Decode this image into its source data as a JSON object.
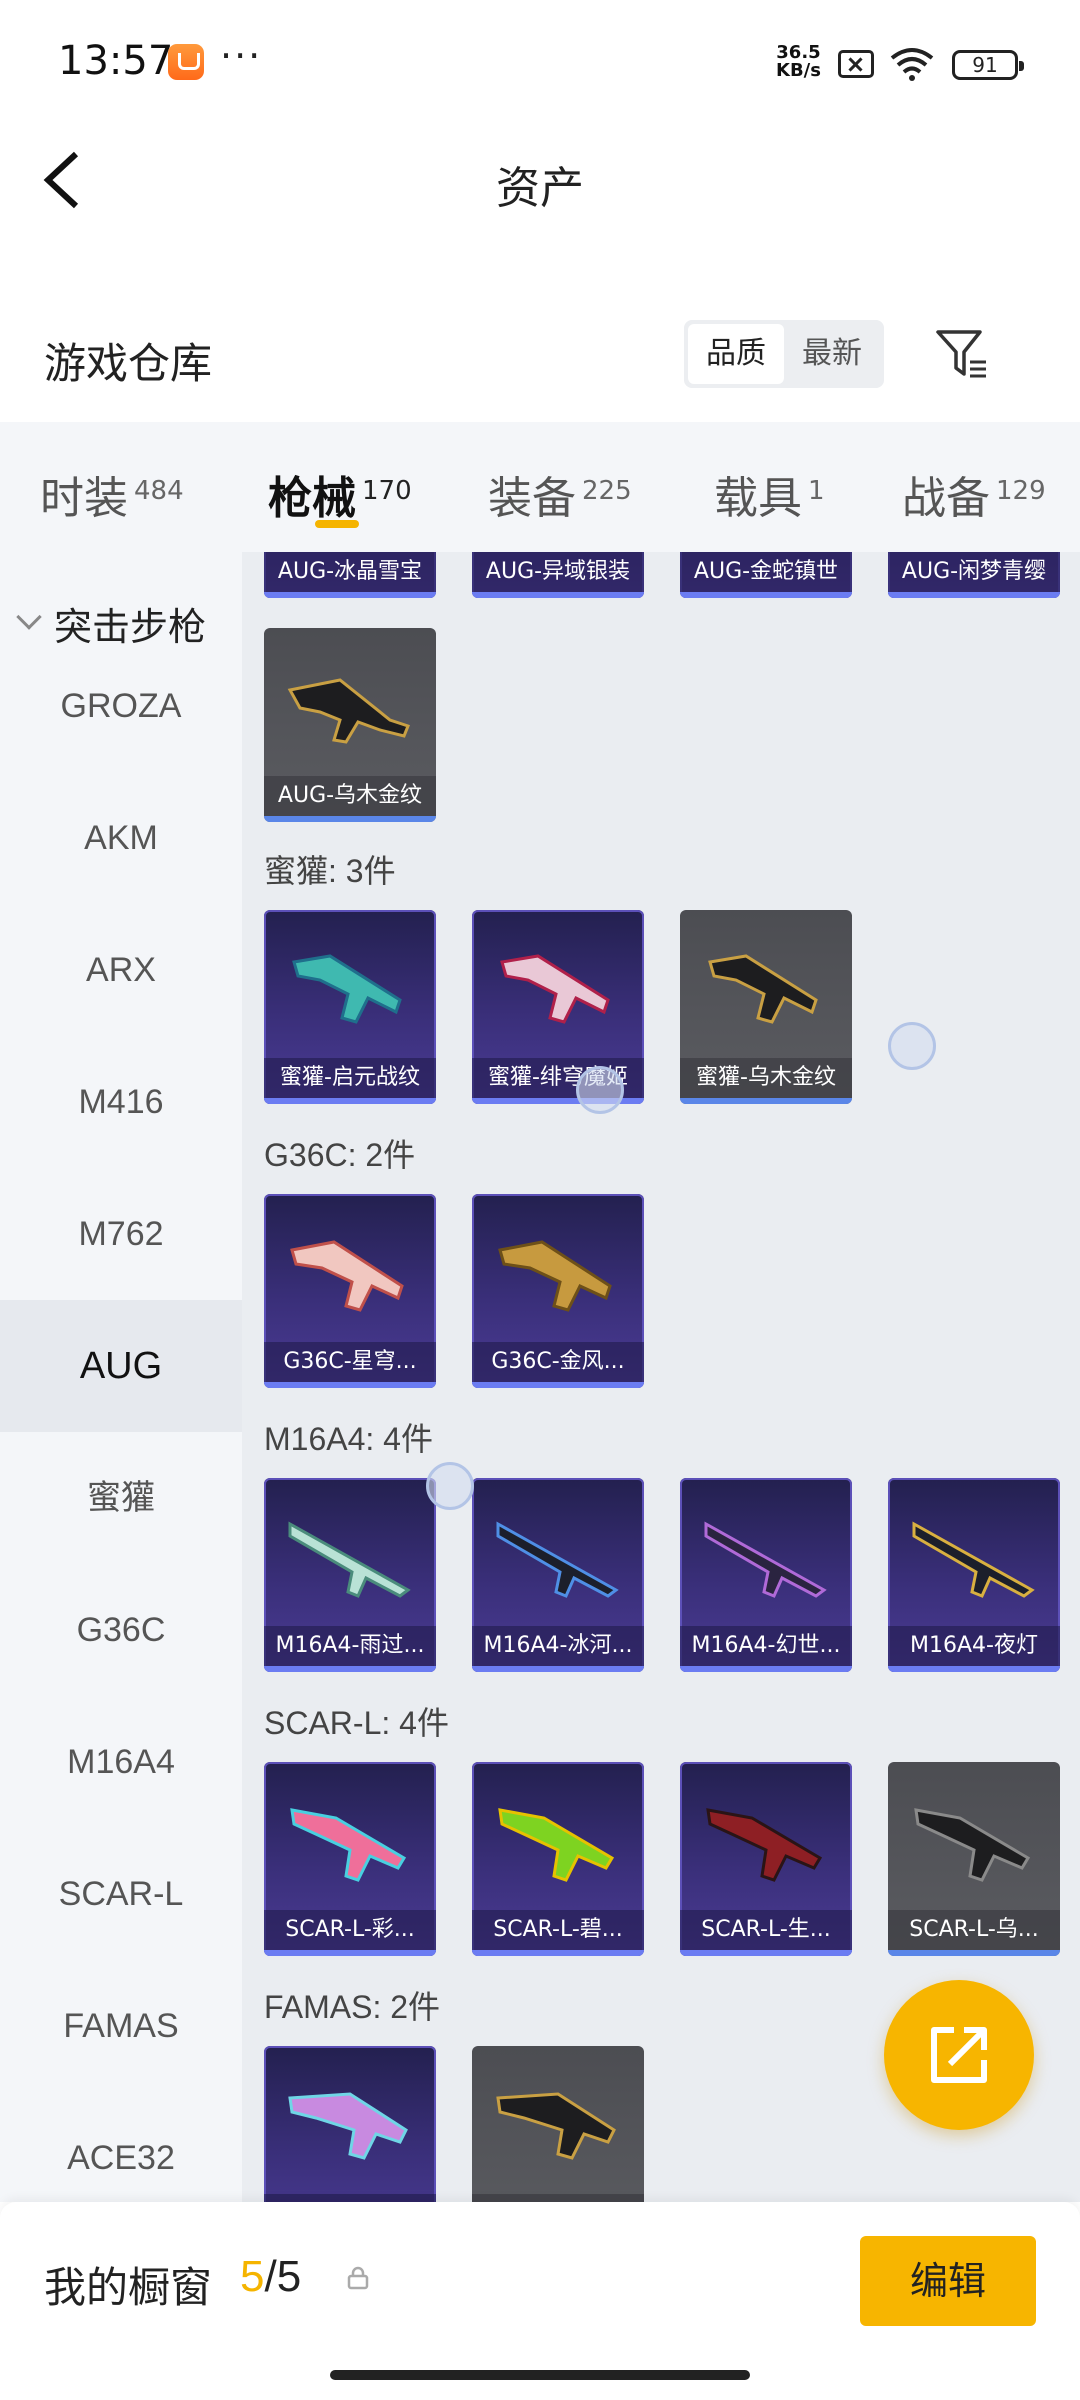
{
  "status_bar": {
    "time": "13:57",
    "more": "···",
    "net_speed_value": "36.5",
    "net_speed_unit": "KB/s",
    "battery": "91"
  },
  "header": {
    "title": "资产"
  },
  "warehouse": {
    "title": "游戏仓库",
    "sort_options": [
      "品质",
      "最新"
    ],
    "active_sort": "品质"
  },
  "tabs": [
    {
      "label": "时装",
      "count": "484"
    },
    {
      "label": "枪械",
      "count": "170",
      "active": true
    },
    {
      "label": "装备",
      "count": "225"
    },
    {
      "label": "载具",
      "count": "1"
    },
    {
      "label": "战备",
      "count": "129"
    }
  ],
  "sidebar": {
    "group": "突击步枪",
    "items": [
      "GROZA",
      "AKM",
      "ARX",
      "M416",
      "M762",
      "AUG",
      "蜜獾",
      "G36C",
      "M16A4",
      "SCAR-L",
      "FAMAS",
      "ACE32"
    ],
    "active": "AUG"
  },
  "sections": {
    "aug_row_partial": [
      "AUG-冰晶雪宝",
      "AUG-异域银装",
      "AUG-金蛇镇世",
      "AUG-闲梦青缨"
    ],
    "aug_last": [
      "AUG-乌木金纹"
    ],
    "honey_title": "蜜獾: 3件",
    "honey": [
      "蜜獾-启元战纹",
      "蜜獾-绯穹魔姬",
      "蜜獾-乌木金纹"
    ],
    "g36c_title": "G36C: 2件",
    "g36c": [
      "G36C-星穹...",
      "G36C-金风..."
    ],
    "m16_title": "M16A4: 4件",
    "m16": [
      "M16A4-雨过...",
      "M16A4-冰河...",
      "M16A4-幻世...",
      "M16A4-夜灯"
    ],
    "scar_title": "SCAR-L: 4件",
    "scar": [
      "SCAR-L-彩...",
      "SCAR-L-碧...",
      "SCAR-L-生...",
      "SCAR-L-乌..."
    ],
    "famas_title": "FAMAS: 2件",
    "famas": [
      "",
      ""
    ]
  },
  "bottom": {
    "label": "我的橱窗",
    "current": "5",
    "total": "/5",
    "edit": "编辑"
  },
  "colors": {
    "accent": "#f7b500",
    "purple_card": "#3a2f7a",
    "gray_card": "#55565b"
  }
}
